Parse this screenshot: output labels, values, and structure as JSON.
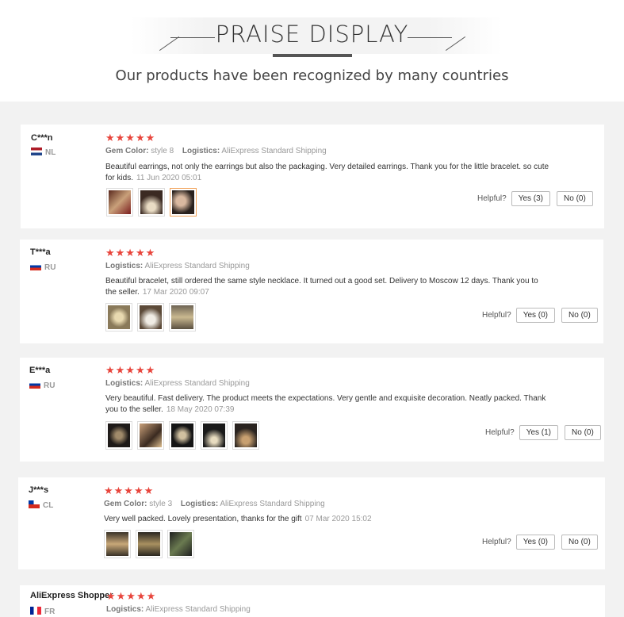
{
  "header": {
    "title": "PRAISE DISPLAY",
    "subtitle": "Our products have been recognized by many countries"
  },
  "labels": {
    "gem_color": "Gem Color:",
    "logistics": "Logistics:",
    "helpful": "Helpful?"
  },
  "colors": {
    "stars": "#e8453c",
    "selected_thumb": "#f2a35a",
    "page_bg": "#f2f2f2"
  },
  "reviews": [
    {
      "user": "C***n",
      "country": "NL",
      "stars": "★★★★★",
      "gem_color": "style 8",
      "logistics": "AliExpress Standard Shipping",
      "text": "Beautiful earrings, not only the earrings but also the packaging. Very detailed earrings. Thank you for the little bracelet. so cute for kids.",
      "date": "11 Jun 2020 05:01",
      "yes": "Yes (3)",
      "no": "No (0)"
    },
    {
      "user": "T***a",
      "country": "RU",
      "stars": "★★★★★",
      "logistics": "AliExpress Standard Shipping",
      "text": "Beautiful bracelet, still ordered the same style necklace. It turned out a good set. Delivery to Moscow 12 days. Thank you to the seller.",
      "date": "17 Mar 2020 09:07",
      "yes": "Yes (0)",
      "no": "No (0)"
    },
    {
      "user": "E***a",
      "country": "RU",
      "stars": "★★★★★",
      "logistics": "AliExpress Standard Shipping",
      "text": "Very beautiful. Fast delivery. The product meets the expectations. Very gentle and exquisite decoration. Neatly packed. Thank you to the seller.",
      "date": "18 May 2020 07:39",
      "yes": "Yes (1)",
      "no": "No (0)"
    },
    {
      "user": "J***s",
      "country": "CL",
      "stars": "★★★★★",
      "gem_color": "style 3",
      "logistics": "AliExpress Standard Shipping",
      "text": "Very well packed. Lovely presentation, thanks for the gift",
      "date": "07 Mar 2020 15:02",
      "yes": "Yes (0)",
      "no": "No (0)"
    },
    {
      "user": "AliExpress Shopper",
      "country": "FR",
      "stars": "★★★★★",
      "logistics": "AliExpress Standard Shipping"
    }
  ]
}
